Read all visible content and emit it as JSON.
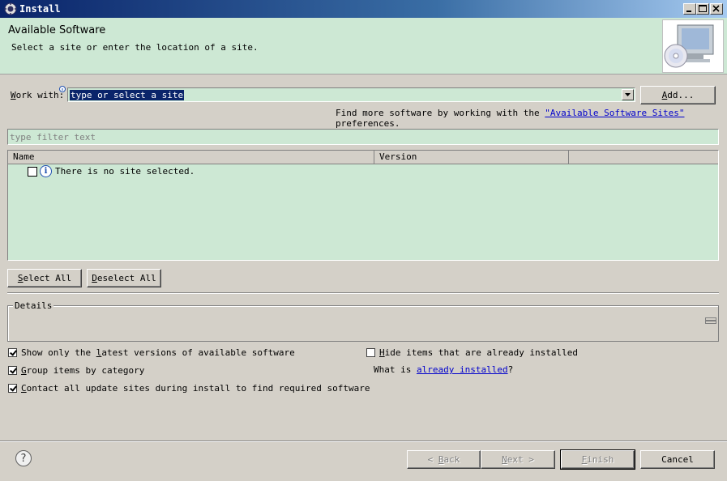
{
  "window": {
    "title": "Install"
  },
  "banner": {
    "title": "Available Software",
    "subtitle": "Select a site or enter the location of a site."
  },
  "work_with": {
    "label_prefix": "W",
    "label_rest": "ork with:",
    "value": "type or select a site",
    "add_button": "Add...",
    "add_mnemonic": "A",
    "add_rest": "dd..."
  },
  "find_more": {
    "prefix": "Find more software by working with the ",
    "link": "\"Available Software Sites\"",
    "suffix": " preferences."
  },
  "filter": {
    "placeholder": "type filter text"
  },
  "table": {
    "columns": [
      "Name",
      "Version",
      ""
    ],
    "rows": [
      {
        "text": "There is no site selected."
      }
    ]
  },
  "buttons": {
    "select_all_m": "S",
    "select_all_rest": "elect All",
    "deselect_all_m": "D",
    "deselect_all_rest": "eselect All"
  },
  "details": {
    "title": "Details"
  },
  "options": {
    "latest": {
      "pre": "Show only the ",
      "m": "l",
      "post": "atest versions of available software",
      "checked": true
    },
    "group": {
      "pre": "",
      "m": "G",
      "post": "roup items by category",
      "checked": true
    },
    "contact": {
      "pre": "",
      "m": "C",
      "post": "ontact all update sites during install to find required software",
      "checked": true
    },
    "hide": {
      "pre": "",
      "m": "H",
      "post": "ide items that are already installed",
      "checked": false
    },
    "what_is_prefix": "What is ",
    "what_is_link": "already installed",
    "what_is_suffix": "?"
  },
  "footer": {
    "back": "< Back",
    "back_m": "B",
    "next": "Next >",
    "next_m": "N",
    "finish": "Finish",
    "finish_m": "F",
    "cancel": "Cancel"
  }
}
